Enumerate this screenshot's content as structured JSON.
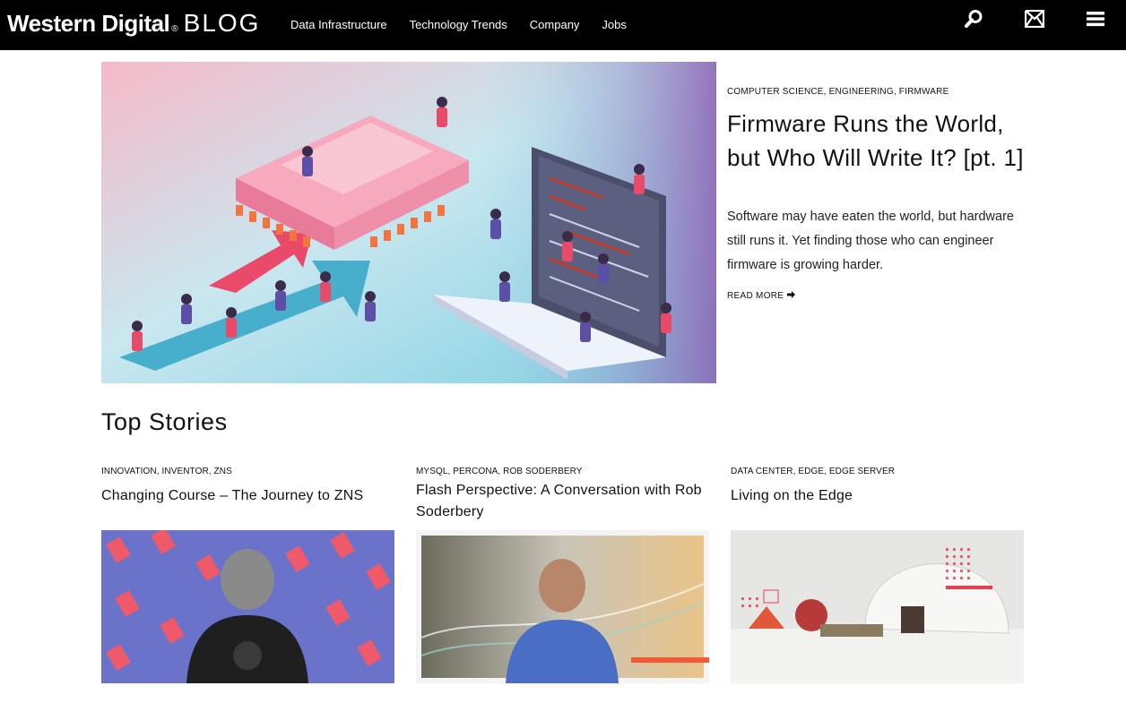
{
  "header": {
    "brand_name": "Western Digital",
    "brand_section": "BLOG",
    "nav": [
      "Data Infrastructure",
      "Technology Trends",
      "Company",
      "Jobs"
    ],
    "icons": [
      "search-icon",
      "mail-icon",
      "menu-icon"
    ]
  },
  "hero": {
    "tags": "COMPUTER SCIENCE, ENGINEERING, FIRMWARE",
    "title": "Firmware Runs the World, but Who Will Write It? [pt. 1]",
    "excerpt": "Software may have eaten the world, but hardware still runs it. Yet finding those who can engineer firmware is growing harder.",
    "read_more": "READ MORE"
  },
  "top_stories": {
    "title": "Top Stories",
    "items": [
      {
        "tags": "INNOVATION, INVENTOR, ZNS",
        "title": "Changing Course – The Journey to ZNS"
      },
      {
        "tags": "MYSQL, PERCONA, ROB SODERBERY",
        "title": "Flash Perspective: A Conversation with Rob Soderbery"
      },
      {
        "tags": "DATA CENTER, EDGE, EDGE SERVER",
        "title": "Living on the Edge"
      }
    ]
  },
  "colors": {
    "header_bg": "#000000",
    "accent_red": "#e8404f",
    "hero_blue": "#7fd3e6",
    "card1_bg": "#6a73c9"
  }
}
